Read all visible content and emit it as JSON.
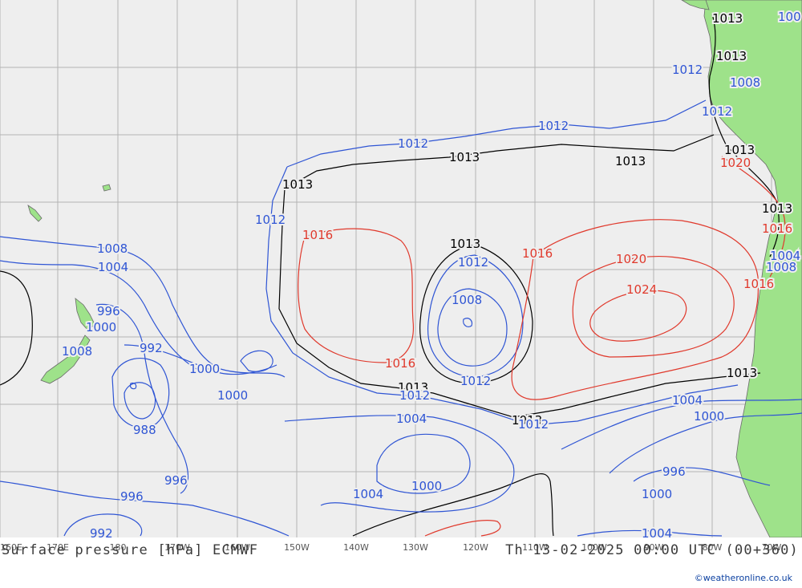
{
  "map": {
    "ocean_color": "#eeeeee",
    "land_color": "#9ee28a",
    "grid_color": "#b4b4b4",
    "lon_labels": [
      "160E",
      "170E",
      "180",
      "170W",
      "160W",
      "150W",
      "140W",
      "130W",
      "120W",
      "110W",
      "100W",
      "90W",
      "80W",
      "70W"
    ]
  },
  "isobars": {
    "colors": {
      "low": "#2f55d4",
      "standard": "#000000",
      "high": "#e0392c"
    },
    "labels": [
      {
        "text": "1013",
        "kind": "standard"
      },
      {
        "text": "1013",
        "kind": "standard"
      },
      {
        "text": "1013",
        "kind": "standard"
      },
      {
        "text": "1013",
        "kind": "standard"
      },
      {
        "text": "1013",
        "kind": "standard"
      },
      {
        "text": "1013",
        "kind": "standard"
      },
      {
        "text": "1013",
        "kind": "standard"
      },
      {
        "text": "1013",
        "kind": "standard"
      },
      {
        "text": "1013",
        "kind": "standard"
      },
      {
        "text": "1013",
        "kind": "standard"
      },
      {
        "text": "1013",
        "kind": "standard"
      },
      {
        "text": "1012",
        "kind": "low"
      },
      {
        "text": "1012",
        "kind": "low"
      },
      {
        "text": "1012",
        "kind": "low"
      },
      {
        "text": "1012",
        "kind": "low"
      },
      {
        "text": "1012",
        "kind": "low"
      },
      {
        "text": "1012",
        "kind": "low"
      },
      {
        "text": "1012",
        "kind": "low"
      },
      {
        "text": "1012",
        "kind": "low"
      },
      {
        "text": "1012",
        "kind": "low"
      },
      {
        "text": "1008",
        "kind": "low"
      },
      {
        "text": "1008",
        "kind": "low"
      },
      {
        "text": "1008",
        "kind": "low"
      },
      {
        "text": "1008",
        "kind": "low"
      },
      {
        "text": "1008",
        "kind": "low"
      },
      {
        "text": "1004",
        "kind": "low"
      },
      {
        "text": "1004",
        "kind": "low"
      },
      {
        "text": "1004",
        "kind": "low"
      },
      {
        "text": "1004",
        "kind": "low"
      },
      {
        "text": "1004",
        "kind": "low"
      },
      {
        "text": "1004",
        "kind": "low"
      },
      {
        "text": "1000",
        "kind": "low"
      },
      {
        "text": "1000",
        "kind": "low"
      },
      {
        "text": "1000",
        "kind": "low"
      },
      {
        "text": "1000",
        "kind": "low"
      },
      {
        "text": "1000",
        "kind": "low"
      },
      {
        "text": "1000",
        "kind": "low"
      },
      {
        "text": "996",
        "kind": "low"
      },
      {
        "text": "996",
        "kind": "low"
      },
      {
        "text": "996",
        "kind": "low"
      },
      {
        "text": "996",
        "kind": "low"
      },
      {
        "text": "992",
        "kind": "low"
      },
      {
        "text": "992",
        "kind": "low"
      },
      {
        "text": "988",
        "kind": "low"
      },
      {
        "text": "1016",
        "kind": "high"
      },
      {
        "text": "1016",
        "kind": "high"
      },
      {
        "text": "1016",
        "kind": "high"
      },
      {
        "text": "1016",
        "kind": "high"
      },
      {
        "text": "1016",
        "kind": "high"
      },
      {
        "text": "1020",
        "kind": "high"
      },
      {
        "text": "1020",
        "kind": "high"
      },
      {
        "text": "1024",
        "kind": "high"
      },
      {
        "text": "100",
        "kind": "low"
      }
    ]
  },
  "footer": {
    "title": "Surface pressure [hPa] ECMWF",
    "datetime": "Th 13-02-2025 00:00 UTC (00+360)",
    "credit": "©weatheronline.co.uk"
  }
}
